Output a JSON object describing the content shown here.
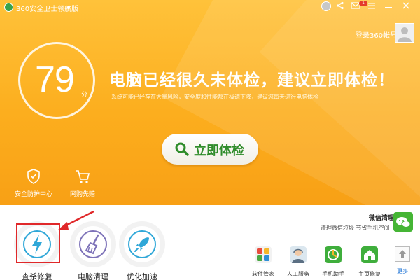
{
  "window": {
    "title": "360安全卫士领航版"
  },
  "account": {
    "login_label": "登录360帐号"
  },
  "score": {
    "value": "79",
    "unit": "分"
  },
  "status": {
    "headline": "电脑已经很久未体检，建议立即体检！",
    "detail": "系统可能已经存在大量风险，安全度和性能都在极速下降，建议您每天进行电脑体检"
  },
  "check_button": {
    "label": "立即体检"
  },
  "shortcuts": [
    {
      "label": "安全防护中心",
      "icon": "shield-icon"
    },
    {
      "label": "网购先赔",
      "icon": "cart-icon"
    }
  ],
  "tools": [
    {
      "label": "查杀修复",
      "icon": "lightning-icon"
    },
    {
      "label": "电脑清理",
      "icon": "broom-icon"
    },
    {
      "label": "优化加速",
      "icon": "rocket-icon"
    }
  ],
  "wechat": {
    "title": "微信清理",
    "subtitle": "清理微信垃圾 节省手机空间"
  },
  "mini_apps": [
    {
      "label": "软件管家",
      "icon": "app-grid-icon"
    },
    {
      "label": "人工服务",
      "icon": "support-person-icon"
    },
    {
      "label": "手机助手",
      "icon": "phone-helper-icon"
    },
    {
      "label": "主页修复",
      "icon": "home-icon"
    }
  ],
  "more": {
    "label": "更多"
  },
  "badges": {
    "notification_count": "1"
  },
  "colors": {
    "accent_orange": "#fcae1e",
    "button_green": "#2f8c2b",
    "highlight_red": "#e0282a",
    "link_blue": "#2a7bd8"
  }
}
